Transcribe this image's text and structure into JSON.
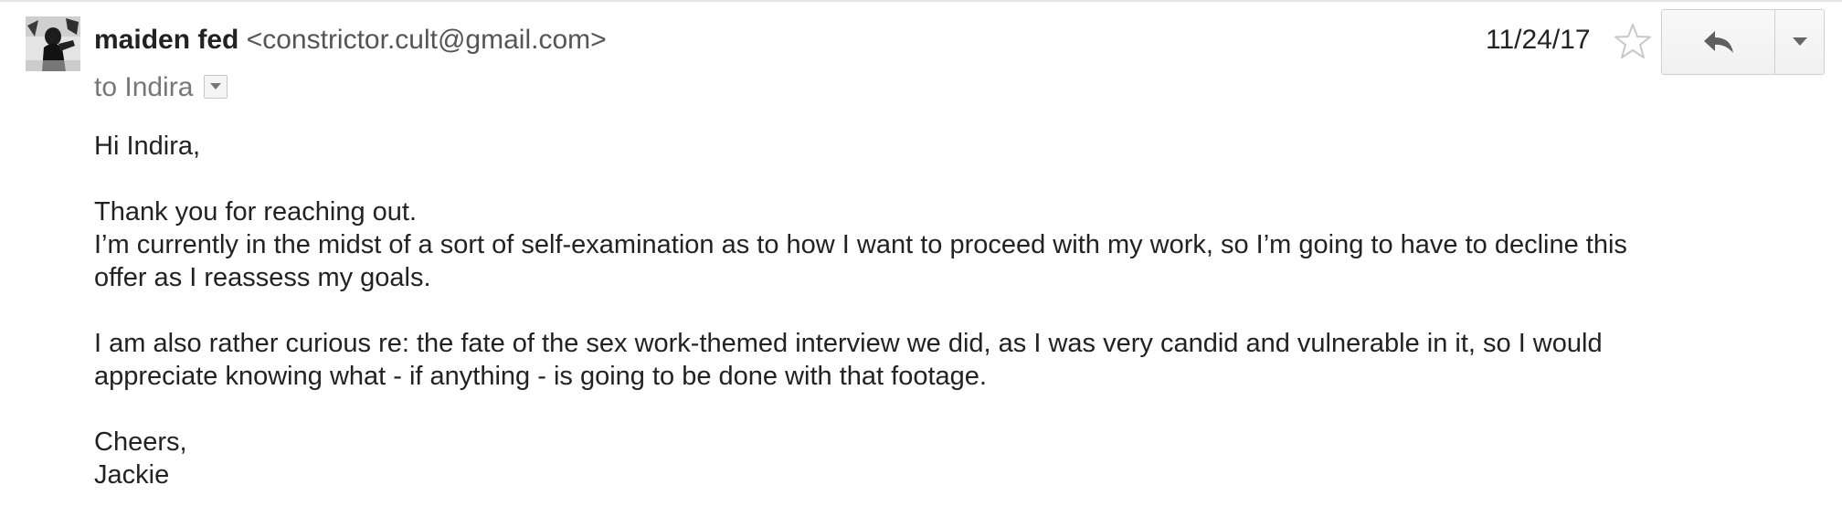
{
  "sender": {
    "name": "maiden fed",
    "email": "<constrictor.cult@gmail.com>"
  },
  "recipient": {
    "label": "to Indira"
  },
  "date": "11/24/17",
  "icons": {
    "avatar": "sender-avatar-photo",
    "star": "star-outline-icon",
    "reply": "reply-arrow-icon",
    "more": "chevron-down-icon",
    "details": "triangle-down-icon"
  },
  "body": {
    "greeting": "Hi Indira,",
    "para1_line1": "Thank you for reaching out.",
    "para1_line2": "I’m currently in the midst of a sort of self-examination as to how I want to proceed with my work, so I’m going to have to decline this",
    "para1_line3": "offer as I reassess my goals.",
    "para2_line1": "I am also rather curious re: the fate of the sex work-themed interview we did, as I was very candid and vulnerable in it, so I would",
    "para2_line2": "appreciate knowing what - if anything - is going to be done with that footage.",
    "signoff": "Cheers,",
    "signature": "Jackie"
  }
}
